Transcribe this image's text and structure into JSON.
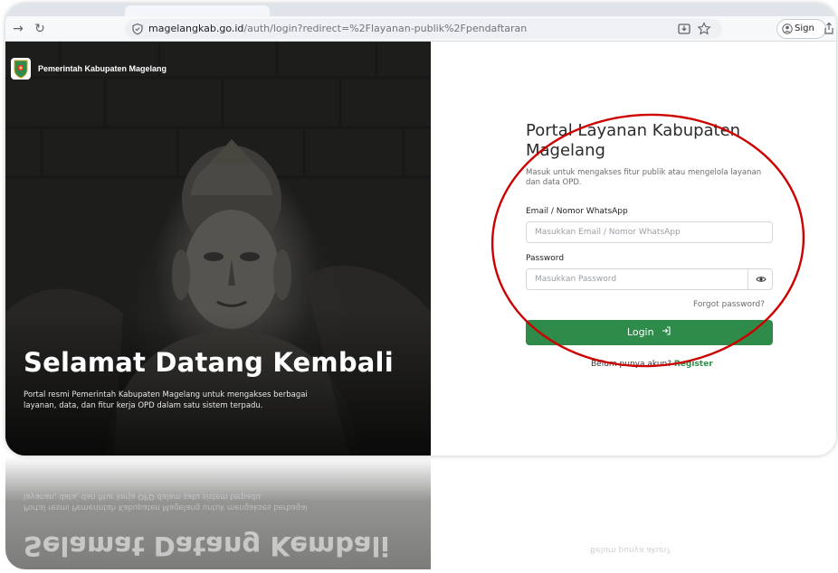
{
  "browser": {
    "url_host": "magelangkab.go.id",
    "url_path": "/auth/login?redirect=%2Flayanan-publik%2Fpendaftaran",
    "signin_label": "Sign in"
  },
  "hero": {
    "brand_name": "Pemerintah Kabupaten Magelang",
    "title": "Selamat Datang Kembali",
    "description": "Portal resmi Pemerintah Kabupaten Magelang untuk mengakses berbagai layanan, data, dan fitur kerja OPD dalam satu sistem terpadu."
  },
  "login": {
    "title": "Portal Layanan Kabupaten Magelang",
    "subtitle": "Masuk untuk mengakses fitur publik atau mengelola layanan dan data OPD.",
    "email_label": "Email / Nomor WhatsApp",
    "email_placeholder": "Masukkan Email / Nomor WhatsApp",
    "password_label": "Password",
    "password_placeholder": "Masukkan Password",
    "forgot_label": "Forgot password?",
    "login_button": "Login",
    "register_prompt": "Belum punya akun?",
    "register_link": "Register"
  },
  "colors": {
    "primary": "#2e8b4a",
    "annotation": "#cc0000"
  },
  "icons": {
    "back": "arrow-right-icon",
    "reload": "reload-icon",
    "site_info": "shield-icon",
    "install": "install-icon",
    "bookmark": "star-icon",
    "password_toggle": "eye-icon",
    "login": "login-arrow-icon"
  }
}
